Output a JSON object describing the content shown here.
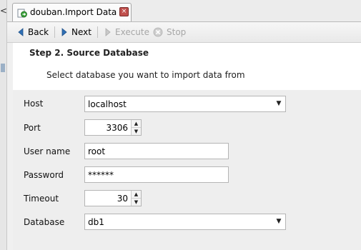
{
  "tab": {
    "title": "douban.Import Data",
    "close_glyph": "×",
    "icon": "import-data-icon"
  },
  "toolbar": {
    "back_label": "Back",
    "next_label": "Next",
    "execute_label": "Execute",
    "stop_label": "Stop"
  },
  "step": {
    "title": "Step 2. Source Database",
    "description": "Select database you want to import data from"
  },
  "form": {
    "host_label": "Host",
    "host_value": "localhost",
    "port_label": "Port",
    "port_value": "3306",
    "username_label": "User name",
    "username_value": "root",
    "password_label": "Password",
    "password_value": "******",
    "timeout_label": "Timeout",
    "timeout_value": "30",
    "database_label": "Database",
    "database_value": "db1"
  },
  "gutter": {
    "arrow_glyph": "<"
  },
  "glyphs": {
    "dropdown": "▼",
    "spin_up": "▲",
    "spin_down": "▼"
  },
  "colors": {
    "accent_arrow": "#2f6fb5",
    "disabled": "#a6a6a6",
    "close_button": "#c0504d"
  }
}
